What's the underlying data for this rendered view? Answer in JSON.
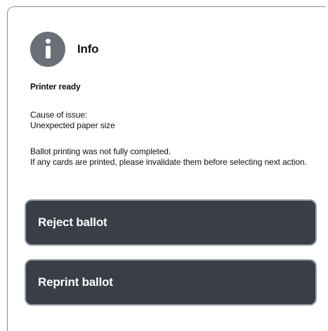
{
  "dialog": {
    "icon": "info-icon",
    "title": "Info",
    "status": "Printer ready",
    "cause_label": "Cause of issue:",
    "cause_value": "Unexpected paper size",
    "message_line1": "Ballot printing was not fully completed.",
    "message_line2": "If any cards are printed, please invalidate them before selecting next action."
  },
  "actions": {
    "reject_label": "Reject ballot",
    "reprint_label": "Reprint ballot"
  },
  "colors": {
    "icon_bg": "#6b6f78",
    "button_bg": "#393e47",
    "button_border": "#9aa0aa",
    "button_text": "#ffffff",
    "text": "#111111"
  }
}
